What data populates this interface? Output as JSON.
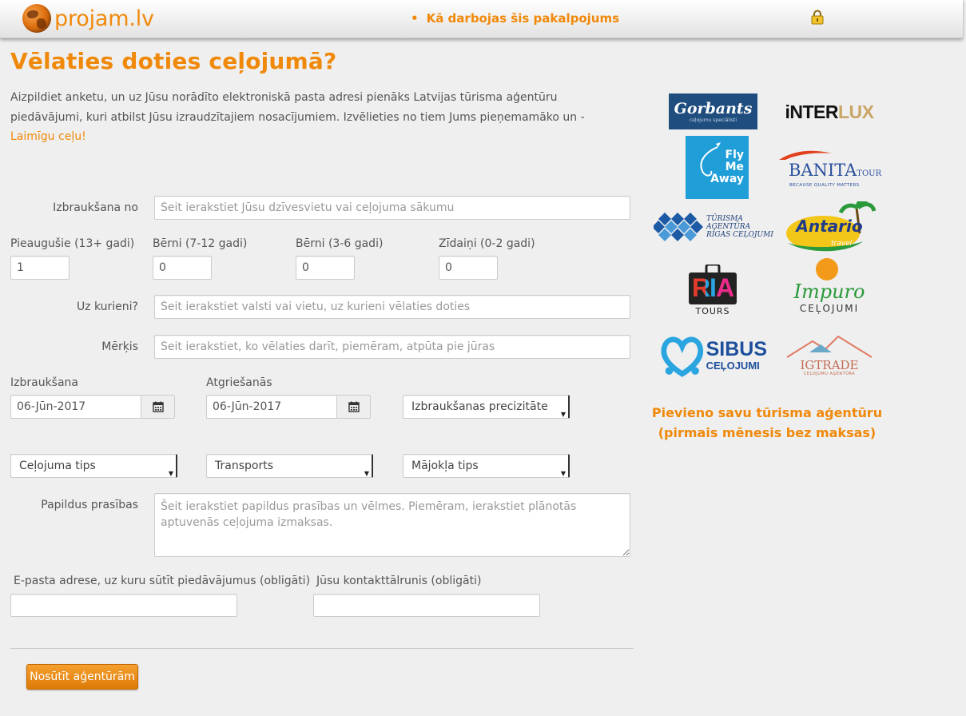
{
  "nav": {
    "brand": "projam.lv",
    "link_bullet": "•",
    "link_label": "Kā darbojas šis pakalpojums"
  },
  "page": {
    "title": "Vēlaties doties ceļojumā?",
    "intro_text": "Aizpildiet anketu, un uz Jūsu norādīto elektroniskā pasta adresi pienāks Latvijas tūrisma aģentūru piedāvājumi, kuri atbilst Jūsu izraudzītajiem nosacījumiem. Izvēlieties no tiem Jums pieņemamāko un - ",
    "intro_link": "Laimīgu ceļu!"
  },
  "form": {
    "departure_from": {
      "label": "Izbraukšana no",
      "placeholder": "Šeit ierakstiet Jūsu dzīvesvietu vai ceļojuma sākumu",
      "value": ""
    },
    "adults": {
      "label": "Pieaugušie (13+ gadi)",
      "value": "1"
    },
    "children_7_12": {
      "label": "Bērni (7-12 gadi)",
      "value": "0"
    },
    "children_3_6": {
      "label": "Bērni (3-6 gadi)",
      "value": "0"
    },
    "infants": {
      "label": "Zīdaiņi (0-2 gadi)",
      "value": "0"
    },
    "destination": {
      "label": "Uz kurieni?",
      "placeholder": "Šeit ierakstiet valsti vai vietu, uz kurieni vēlaties doties",
      "value": ""
    },
    "purpose": {
      "label": "Mērķis",
      "placeholder": "Šeit ierakstiet, ko vēlaties darīt, piemēram, atpūta pie jūras",
      "value": ""
    },
    "departure_date": {
      "label": "Izbraukšana",
      "value": "06-Jūn-2017"
    },
    "return_date": {
      "label": "Atgriešanās",
      "value": "06-Jūn-2017"
    },
    "precision_select": {
      "value": "Izbraukšanas precizitāte"
    },
    "trip_type_select": {
      "value": "Ceļojuma tips"
    },
    "transport_select": {
      "value": "Transports"
    },
    "accommodation_select": {
      "value": "Mājokļa tips"
    },
    "extra": {
      "label": "Papildus prasības",
      "placeholder": "Šeit ierakstiet papildus prasības un vēlmes. Piemēram, ierakstiet plānotās aptuvenās ceļojuma izmaksas.",
      "value": ""
    },
    "email": {
      "label": "E-pasta adrese, uz kuru sūtīt piedāvājumus (obligāti)",
      "value": ""
    },
    "phone": {
      "label": "Jūsu kontakttālrunis (obligāti)",
      "value": ""
    },
    "submit_label": "Nosūtīt aģentūrām"
  },
  "sidebar": {
    "logos": {
      "gorbants": {
        "name": "Gorbants",
        "tagline": "ceļojumu speciālisti"
      },
      "interlux": {
        "name_a": "iNTER",
        "name_b": "LUX"
      },
      "flymeaway": {
        "line1": "Fly",
        "line2": "Me",
        "line3": "Away"
      },
      "banita": {
        "name": "BANITA",
        "suffix": "TOUR",
        "tagline": "BECAUSE QUALITY MATTERS"
      },
      "rigas": {
        "line1": "TŪRISMA",
        "line2": "AĢENTŪRA",
        "line3": "RĪGAS CEĻOJUMI"
      },
      "antario": {
        "name": "Antario",
        "sub": "travel"
      },
      "ria": {
        "name": "RIA",
        "sub": "TOURS"
      },
      "impuro": {
        "name": "Impuro",
        "sub": "CEĻOJUMI"
      },
      "sibus": {
        "name": "SIBUS",
        "sub": "CEĻOJUMI"
      },
      "igtrade": {
        "name": "IGTRADE",
        "sub": "CEĻOJUMU AĢENTŪRA"
      }
    },
    "cta_line1": "Pievieno savu tūrisma aģentūru",
    "cta_line2": "(pirmais mēnesis bez maksas)"
  },
  "colors": {
    "accent": "#f0890a",
    "text": "#555555",
    "page_bg": "#efefef"
  }
}
